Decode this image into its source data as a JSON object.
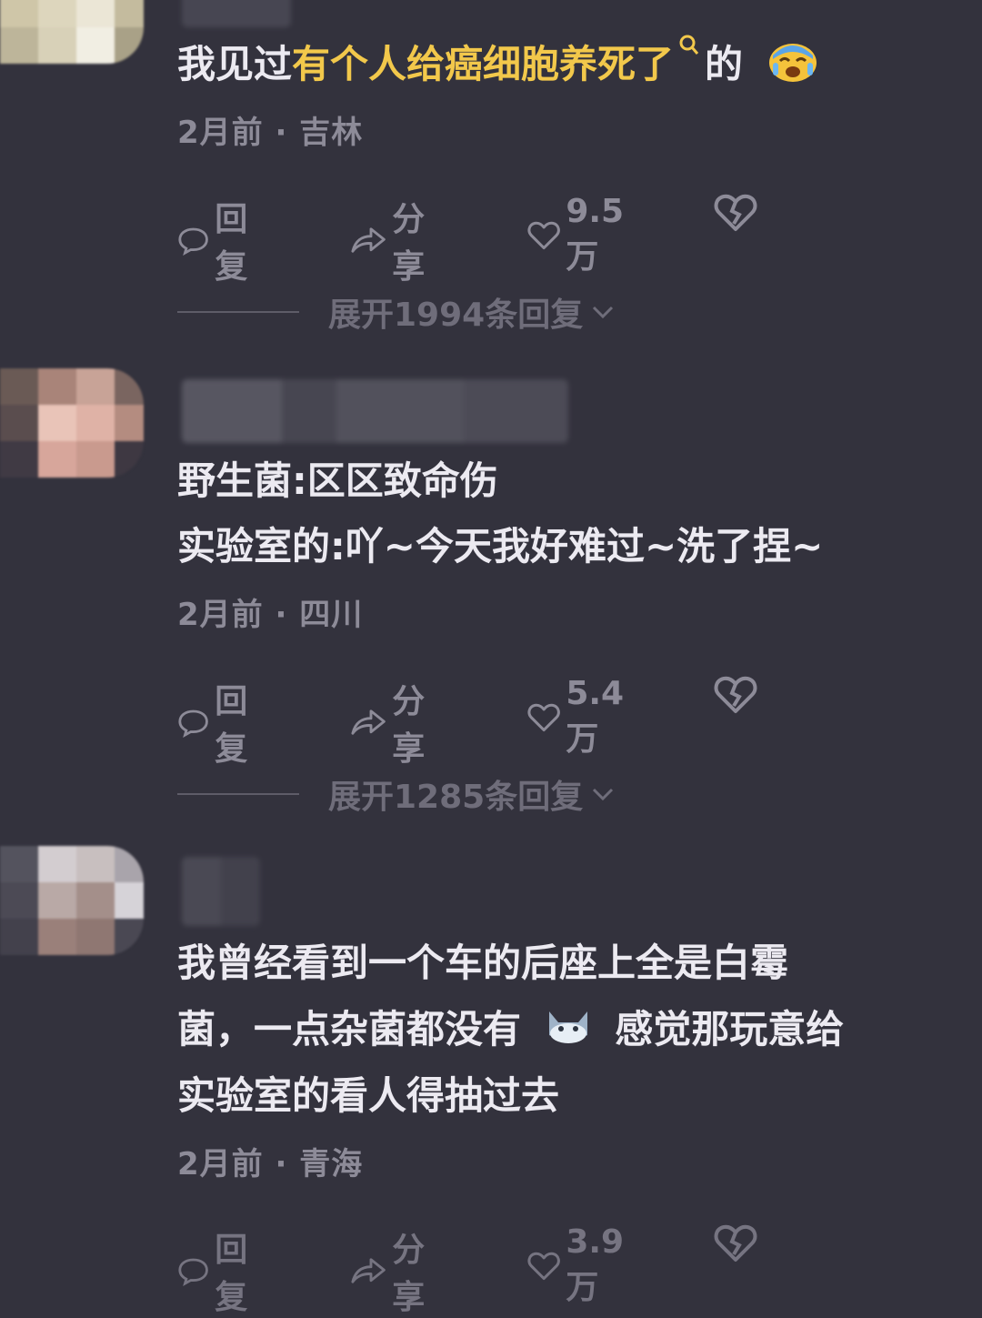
{
  "comments": [
    {
      "text_plain_before": "我见过",
      "text_highlight": "有个人给癌细胞养死了",
      "text_plain_after": "的",
      "emoji": "crying-face-emoji",
      "meta": "2月前 · 吉林",
      "reply_label": "回复",
      "share_label": "分享",
      "likes": "9.5万",
      "expand_label": "展开1994条回复"
    },
    {
      "lines": [
        "野生菌:区区致命伤",
        "实验室的:吖~今天我好难过~洗了捏~"
      ],
      "meta": "2月前 · 四川",
      "reply_label": "回复",
      "share_label": "分享",
      "likes": "5.4万",
      "expand_label": "展开1285条回复"
    },
    {
      "lines": [
        "我曾经看到一个车的后座上全是白霉",
        "菌，一点杂菌都没有",
        "实验室的看人得抽过去"
      ],
      "line2_after_emoji": "感觉那玩意给",
      "emoji": "cat-emoji",
      "meta": "2月前 · 青海",
      "reply_label": "回复",
      "share_label": "分享",
      "likes": "3.9万"
    }
  ],
  "colors": {
    "background": "#33323d",
    "highlight": "#f2c84b",
    "text": "#eceaf1",
    "muted": "#8d8b98"
  }
}
